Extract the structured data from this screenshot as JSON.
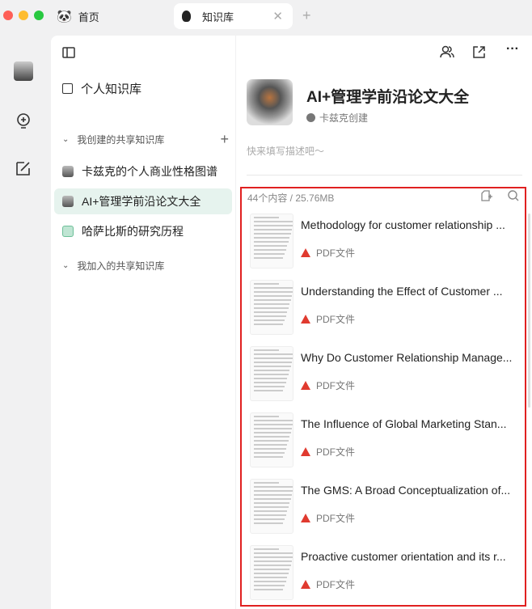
{
  "tabs": [
    {
      "label": "首页",
      "icon": "panda-icon"
    },
    {
      "label": "知识库",
      "icon": "bulb-icon",
      "active": true
    }
  ],
  "sidebar": {
    "personal": "个人知识库",
    "created_group": "我创建的共享知识库",
    "joined_group": "我加入的共享知识库",
    "items": [
      {
        "label": "卡兹克的个人商业性格图谱"
      },
      {
        "label": "AI+管理学前沿论文大全",
        "selected": true
      },
      {
        "label": "哈萨比斯的研究历程"
      }
    ]
  },
  "main": {
    "title": "AI+管理学前沿论文大全",
    "creator": "卡兹克创建",
    "description_placeholder": "快来填写描述吧～",
    "stats": "44个内容 / 25.76MB",
    "items": [
      {
        "title": "Methodology for customer relationship ...",
        "type": "PDF文件"
      },
      {
        "title": "Understanding the Effect of Customer ...",
        "type": "PDF文件"
      },
      {
        "title": "Why Do Customer Relationship Manage...",
        "type": "PDF文件"
      },
      {
        "title": "The Influence of Global Marketing Stan...",
        "type": "PDF文件"
      },
      {
        "title": "The GMS: A Broad Conceptualization of...",
        "type": "PDF文件"
      },
      {
        "title": "Proactive customer orientation and its r...",
        "type": "PDF文件"
      }
    ]
  },
  "colors": {
    "highlight": "#e02020",
    "selected_bg": "#e6f3ee",
    "pdf": "#e03a2f"
  }
}
